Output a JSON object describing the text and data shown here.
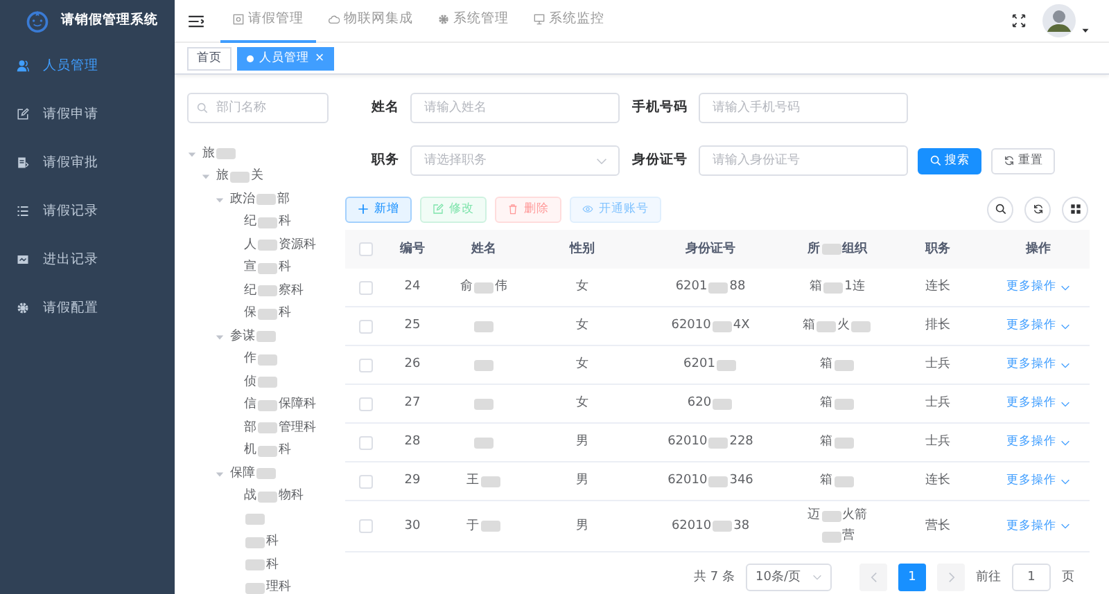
{
  "app": {
    "title": "请销假管理系统"
  },
  "sidebar": {
    "items": [
      {
        "label": "人员管理",
        "selected": true
      },
      {
        "label": "请假申请",
        "selected": false
      },
      {
        "label": "请假审批",
        "selected": false
      },
      {
        "label": "请假记录",
        "selected": false
      },
      {
        "label": "进出记录",
        "selected": false
      },
      {
        "label": "请假配置",
        "selected": false
      }
    ]
  },
  "top_nav": {
    "items": [
      {
        "label": "请假管理",
        "selected": true
      },
      {
        "label": "物联网集成",
        "selected": false
      },
      {
        "label": "系统管理",
        "selected": false
      },
      {
        "label": "系统监控",
        "selected": false
      }
    ]
  },
  "tags": [
    {
      "label": "首页",
      "selected": false
    },
    {
      "label": "人员管理",
      "selected": true,
      "close": "×"
    }
  ],
  "tree": {
    "placeholder": "部门名称",
    "nodes": [
      {
        "label": [
          {
            "text": "旅"
          },
          {
            "kind": "redacted"
          }
        ],
        "expanded": true,
        "children": [
          {
            "label": [
              {
                "text": "旅"
              },
              {
                "kind": "redacted"
              },
              {
                "text": "关"
              }
            ],
            "expanded": true,
            "children": [
              {
                "label": [
                  {
                    "text": "政治"
                  },
                  {
                    "kind": "redacted"
                  },
                  {
                    "text": "部"
                  }
                ],
                "expanded": true,
                "children": [
                  {
                    "label": [
                      {
                        "text": "纪"
                      },
                      {
                        "kind": "redacted"
                      },
                      {
                        "text": "科"
                      }
                    ]
                  },
                  {
                    "label": [
                      {
                        "text": "人"
                      },
                      {
                        "kind": "redacted"
                      },
                      {
                        "text": "资源科"
                      }
                    ]
                  },
                  {
                    "label": [
                      {
                        "text": "宣"
                      },
                      {
                        "kind": "redacted"
                      },
                      {
                        "text": "科"
                      }
                    ]
                  },
                  {
                    "label": [
                      {
                        "text": "纪"
                      },
                      {
                        "kind": "redacted"
                      },
                      {
                        "text": "察科"
                      }
                    ]
                  },
                  {
                    "label": [
                      {
                        "text": "保"
                      },
                      {
                        "kind": "redacted"
                      },
                      {
                        "text": "科"
                      }
                    ]
                  }
                ]
              },
              {
                "label": [
                  {
                    "text": "参谋"
                  },
                  {
                    "kind": "redacted"
                  }
                ],
                "expanded": true,
                "children": [
                  {
                    "label": [
                      {
                        "text": "作"
                      },
                      {
                        "kind": "redacted"
                      }
                    ]
                  },
                  {
                    "label": [
                      {
                        "text": "侦"
                      },
                      {
                        "kind": "redacted"
                      }
                    ]
                  },
                  {
                    "label": [
                      {
                        "text": "信"
                      },
                      {
                        "kind": "redacted"
                      },
                      {
                        "text": "保障科"
                      }
                    ]
                  },
                  {
                    "label": [
                      {
                        "text": "部"
                      },
                      {
                        "kind": "redacted"
                      },
                      {
                        "text": "管理科"
                      }
                    ]
                  },
                  {
                    "label": [
                      {
                        "text": "机"
                      },
                      {
                        "kind": "redacted"
                      },
                      {
                        "text": "科"
                      }
                    ]
                  }
                ]
              },
              {
                "label": [
                  {
                    "text": "保障"
                  },
                  {
                    "kind": "redacted"
                  }
                ],
                "expanded": true,
                "children": [
                  {
                    "label": [
                      {
                        "text": "战"
                      },
                      {
                        "kind": "redacted"
                      },
                      {
                        "text": "物科"
                      }
                    ]
                  },
                  {
                    "label": [
                      {
                        "kind": "redacted"
                      }
                    ]
                  },
                  {
                    "label": [
                      {
                        "kind": "redacted"
                      },
                      {
                        "text": "科"
                      }
                    ]
                  },
                  {
                    "label": [
                      {
                        "kind": "redacted"
                      },
                      {
                        "text": "科"
                      }
                    ]
                  },
                  {
                    "label": [
                      {
                        "kind": "redacted"
                      },
                      {
                        "text": "理科"
                      }
                    ]
                  }
                ]
              }
            ]
          }
        ]
      }
    ]
  },
  "form": {
    "fields": [
      {
        "label": "姓名",
        "kind": "input",
        "placeholder": "请输入姓名"
      },
      {
        "label": "手机号码",
        "kind": "input",
        "placeholder": "请输入手机号码"
      },
      {
        "label": "职务",
        "kind": "select",
        "placeholder": "请选择职务"
      },
      {
        "label": "身份证号",
        "kind": "input",
        "placeholder": "请输入身份证号"
      }
    ],
    "buttons": [
      {
        "label": "搜索",
        "kind": "primary"
      },
      {
        "label": "重置",
        "kind": "default"
      }
    ]
  },
  "toolbar": {
    "buttons": [
      {
        "label": "新增",
        "kind": "primary",
        "disabled": false
      },
      {
        "label": "修改",
        "kind": "success",
        "disabled": true
      },
      {
        "label": "删除",
        "kind": "danger",
        "disabled": true
      },
      {
        "label": "开通账号",
        "kind": "info",
        "disabled": true
      }
    ]
  },
  "table": {
    "columns": [
      "编号",
      "姓名",
      "性别",
      "身份证号",
      [
        {
          "text": "所"
        },
        {
          "kind": "redacted"
        },
        {
          "text": "组织"
        }
      ],
      "职务",
      "操作"
    ],
    "header_checked": false,
    "rows": [
      {
        "checked": false,
        "id": "24",
        "name": [
          {
            "text": "俞"
          },
          {
            "kind": "redacted"
          },
          {
            "text": "伟"
          }
        ],
        "gender": "女",
        "id_card": [
          {
            "text": "6201"
          },
          {
            "kind": "redacted"
          },
          {
            "text": "88"
          }
        ],
        "org": [
          {
            "text": "箱"
          },
          {
            "kind": "redacted"
          },
          {
            "text": "1连"
          }
        ],
        "position": "连长",
        "action": "更多操作"
      },
      {
        "checked": false,
        "id": "25",
        "name": [
          {
            "kind": "redacted"
          }
        ],
        "gender": "女",
        "id_card": [
          {
            "text": "62010"
          },
          {
            "kind": "redacted"
          },
          {
            "text": "4X"
          }
        ],
        "org": [
          {
            "text": "箱"
          },
          {
            "kind": "redacted"
          },
          {
            "text": "火"
          },
          {
            "kind": "redacted"
          }
        ],
        "position": "排长",
        "action": "更多操作"
      },
      {
        "checked": false,
        "id": "26",
        "name": [
          {
            "kind": "redacted"
          }
        ],
        "gender": "女",
        "id_card": [
          {
            "text": "6201"
          },
          {
            "kind": "redacted"
          }
        ],
        "org": [
          {
            "text": "箱"
          },
          {
            "kind": "redacted"
          }
        ],
        "position": "士兵",
        "action": "更多操作"
      },
      {
        "checked": false,
        "id": "27",
        "name": [
          {
            "kind": "redacted"
          }
        ],
        "gender": "女",
        "id_card": [
          {
            "text": "620"
          },
          {
            "kind": "redacted"
          }
        ],
        "org": [
          {
            "text": "箱"
          },
          {
            "kind": "redacted"
          }
        ],
        "position": "士兵",
        "action": "更多操作"
      },
      {
        "checked": false,
        "id": "28",
        "name": [
          {
            "kind": "redacted"
          }
        ],
        "gender": "男",
        "id_card": [
          {
            "text": "62010"
          },
          {
            "kind": "redacted"
          },
          {
            "text": "228"
          }
        ],
        "org": [
          {
            "text": "箱"
          },
          {
            "kind": "redacted"
          }
        ],
        "position": "士兵",
        "action": "更多操作"
      },
      {
        "checked": false,
        "id": "29",
        "name": [
          {
            "text": "王"
          },
          {
            "kind": "redacted"
          }
        ],
        "gender": "男",
        "id_card": [
          {
            "text": "62010"
          },
          {
            "kind": "redacted"
          },
          {
            "text": "346"
          }
        ],
        "org": [
          {
            "text": "箱"
          },
          {
            "kind": "redacted"
          }
        ],
        "position": "连长",
        "action": "更多操作"
      },
      {
        "checked": false,
        "id": "30",
        "name": [
          {
            "text": "于"
          },
          {
            "kind": "redacted"
          }
        ],
        "gender": "男",
        "id_card": [
          {
            "text": "62010"
          },
          {
            "kind": "redacted"
          },
          {
            "text": "38"
          }
        ],
        "org": [
          {
            "text": "迈"
          },
          {
            "kind": "redacted"
          },
          {
            "text": "火箭"
          },
          {
            "kind": "redacted"
          },
          {
            "text": "营"
          }
        ],
        "position": "营长",
        "action": "更多操作"
      }
    ]
  },
  "pagination": {
    "total": "共 7 条",
    "page_size": "10条/页",
    "pages": [
      {
        "label": "1",
        "selected": true
      }
    ],
    "jump_label": "前往",
    "jump_value": "1",
    "jump_suffix": "页"
  }
}
